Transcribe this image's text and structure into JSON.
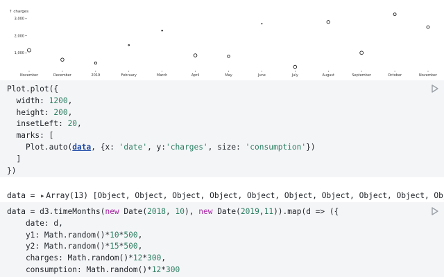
{
  "chart_data": {
    "type": "scatter",
    "ylabel": "↑ charges",
    "yticks": [
      1000,
      2000,
      3000
    ],
    "ytick_labels": [
      "1,000",
      "2,000",
      "3,000"
    ],
    "ylim": [
      0,
      3600
    ],
    "x_tick_labels": [
      "November",
      "December",
      "2019",
      "February",
      "March",
      "April",
      "May",
      "June",
      "July",
      "August",
      "September",
      "October",
      "November"
    ],
    "size_field": "consumption",
    "points": [
      {
        "x": "2018-11",
        "y": 1150,
        "r": 2.5
      },
      {
        "x": "2018-12",
        "y": 600,
        "r": 2.3
      },
      {
        "x": "2019-01",
        "y": 400,
        "r": 1.6
      },
      {
        "x": "2019-02",
        "y": 1450,
        "r": 0.8
      },
      {
        "x": "2019-03",
        "y": 2300,
        "r": 0.8
      },
      {
        "x": "2019-04",
        "y": 850,
        "r": 2.3
      },
      {
        "x": "2019-05",
        "y": 800,
        "r": 1.8
      },
      {
        "x": "2019-06",
        "y": 2700,
        "r": 0.6
      },
      {
        "x": "2019-07",
        "y": 180,
        "r": 2.3
      },
      {
        "x": "2019-08",
        "y": 2800,
        "r": 2.2
      },
      {
        "x": "2019-09",
        "y": 1000,
        "r": 2.4
      },
      {
        "x": "2019-10",
        "y": 3250,
        "r": 2.0
      },
      {
        "x": "2019-11",
        "y": 2500,
        "r": 2.0
      }
    ],
    "grid": false
  },
  "cell_plot": {
    "lines": [
      [
        [
          "fn",
          "Plot.plot"
        ],
        [
          "op",
          "({"
        ]
      ],
      [
        [
          "ident",
          "  width: "
        ],
        [
          "num",
          "1200"
        ],
        [
          "op",
          ","
        ]
      ],
      [
        [
          "ident",
          "  height: "
        ],
        [
          "num",
          "200"
        ],
        [
          "op",
          ","
        ]
      ],
      [
        [
          "ident",
          "  insetLeft: "
        ],
        [
          "num",
          "20"
        ],
        [
          "op",
          ","
        ]
      ],
      [
        [
          "ident",
          "  marks: ["
        ]
      ],
      [
        [
          "ident",
          "    Plot.auto("
        ],
        [
          "var",
          "data"
        ],
        [
          "op",
          ", {x: "
        ],
        [
          "str",
          "'date'"
        ],
        [
          "op",
          ", y:"
        ],
        [
          "str",
          "'charges'"
        ],
        [
          "op",
          ", size: "
        ],
        [
          "str",
          "'consumption'"
        ],
        [
          "op",
          "})"
        ]
      ],
      [
        [
          "ident",
          "  ]"
        ]
      ],
      [
        [
          "op",
          "})"
        ]
      ]
    ]
  },
  "cell_output": {
    "name": "data = ",
    "summary": "Array(13) [Object, Object, Object, Object, Object, Object, Object, Object, Object, Objec"
  },
  "cell_data": {
    "lines": [
      [
        [
          "ident",
          "data = d3.timeMonths("
        ],
        [
          "kw",
          "new"
        ],
        [
          "ident",
          " Date("
        ],
        [
          "num",
          "2018"
        ],
        [
          "op",
          ", "
        ],
        [
          "num",
          "10"
        ],
        [
          "op",
          "), "
        ],
        [
          "kw",
          "new"
        ],
        [
          "ident",
          " Date("
        ],
        [
          "num",
          "2019"
        ],
        [
          "op",
          ","
        ],
        [
          "num",
          "11"
        ],
        [
          "op",
          ")).map(d => ({"
        ]
      ],
      [
        [
          "ident",
          "    date: d,"
        ]
      ],
      [
        [
          "ident",
          "    y1: Math.random()*"
        ],
        [
          "num",
          "10"
        ],
        [
          "op",
          "*"
        ],
        [
          "num",
          "500"
        ],
        [
          "op",
          ","
        ]
      ],
      [
        [
          "ident",
          "    y2: Math.random()*"
        ],
        [
          "num",
          "15"
        ],
        [
          "op",
          "*"
        ],
        [
          "num",
          "500"
        ],
        [
          "op",
          ","
        ]
      ],
      [
        [
          "ident",
          "    charges: Math.random()*"
        ],
        [
          "num",
          "12"
        ],
        [
          "op",
          "*"
        ],
        [
          "num",
          "300"
        ],
        [
          "op",
          ","
        ]
      ],
      [
        [
          "ident",
          "    consumption: Math.random()*"
        ],
        [
          "num",
          "12"
        ],
        [
          "op",
          "*"
        ],
        [
          "num",
          "300"
        ]
      ]
    ]
  }
}
